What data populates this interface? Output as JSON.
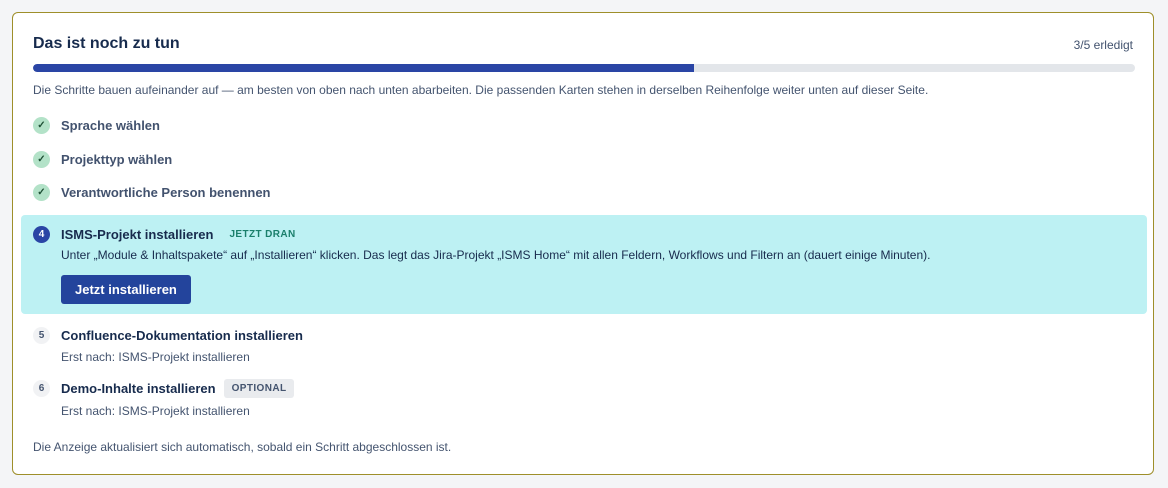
{
  "checklist": {
    "title": "Das ist noch zu tun",
    "count": "3/5 erledigt",
    "progress_fraction": 0.6,
    "intro": "Die Schritte bauen aufeinander auf — am besten von oben nach unten abarbeiten. Die passenden Karten stehen in derselben Reihenfolge weiter unten auf dieser Seite.",
    "done_icon": "✓",
    "steps": [
      {
        "label": "Sprache wählen",
        "status": "done"
      },
      {
        "label": "Projekttyp wählen",
        "status": "done"
      },
      {
        "label": "Verantwortliche Person benennen",
        "status": "done"
      },
      {
        "number": "4",
        "label": "ISMS-Projekt installieren",
        "status": "current",
        "badge": "JETZT DRAN",
        "description": "Unter „Module & Inhaltspakete“ auf „Installieren“ klicken. Das legt das Jira-Projekt „ISMS Home“ mit allen Feldern, Workflows und Filtern an (dauert einige Minuten).",
        "button": "Jetzt installieren"
      },
      {
        "number": "5",
        "label": "Confluence-Dokumentation installieren",
        "status": "pending",
        "dependency": "Erst nach: ISMS-Projekt installieren"
      },
      {
        "number": "6",
        "label": "Demo-Inhalte installieren",
        "status": "pending",
        "badge": "OPTIONAL",
        "dependency": "Erst nach: ISMS-Projekt installieren"
      }
    ],
    "footer": "Die Anzeige aktualisiert sich automatisch, sobald ein Schritt abgeschlossen ist."
  },
  "colors": {
    "progress_fill": "#2a45a5",
    "progress_track": "#e3e6ea",
    "active_background": "#bdf1f3",
    "primary_button": "#23449c",
    "done_dot": "#b3e2c8",
    "card_border": "#9e8f2a"
  }
}
